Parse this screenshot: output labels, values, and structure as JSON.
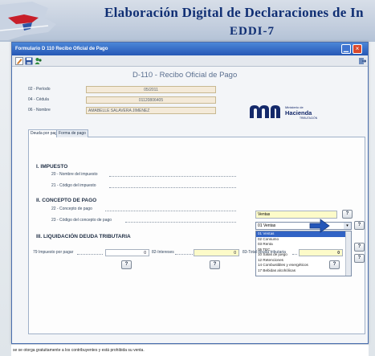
{
  "banner": {
    "title": "Elaboración Digital de Declaraciones de In",
    "subtitle": "EDDI-7"
  },
  "window": {
    "title": "Formulario D 110 Recibo Oficial de Pago"
  },
  "form": {
    "title": "D-110 - Recibo Oficial de Pago",
    "periodo_label": "02 - Período",
    "periodo_value": "05/2011",
    "cedula_label": "04 - Cédula",
    "cedula_value": "01120806405",
    "nombre_label": "06 - Nombre",
    "nombre_value": "AMABELLE SALAVERA JIMENEZ"
  },
  "logo": {
    "text_main": "Hacienda",
    "text_top": "Ministerio de",
    "text_sub": "TRIBUTACIÓN"
  },
  "tabs": [
    {
      "label": "Deuda por pagar"
    },
    {
      "label": "Forma de pago"
    }
  ],
  "section1": {
    "title": "I. IMPUESTO",
    "f20_label": "20 - Nombre del impuesto",
    "f20_value": "Ventas",
    "f21_label": "21 - Código del impuesto",
    "f21_value": "01 Ventas",
    "options": [
      "01 Ventas",
      "02 Consumo",
      "03 Renta",
      "05 TEC",
      "10 Salas de juego",
      "12 Retenciones",
      "14 Combustibles y energéticos",
      "17 Bebidas alcohólicas"
    ]
  },
  "section2": {
    "title": "II. CONCEPTO DE PAGO",
    "f22_label": "22 - Concepto de pago",
    "f23_label": "23 - Código del concepto de pago"
  },
  "section3": {
    "title": "III. LIQUIDACIÓN DEUDA TRIBUTARIA",
    "f79_label": "79 Impuesto por pagar",
    "f79_value": "0",
    "f82_label": "82-Intereses",
    "f82_value": "0",
    "f83_label": "83-Total deuda tributaria",
    "f83_value": "0"
  },
  "help_label": "?",
  "footer": {
    "text": "se se otorga gratuitamente a los contribuyentes y está prohibida su venta."
  }
}
